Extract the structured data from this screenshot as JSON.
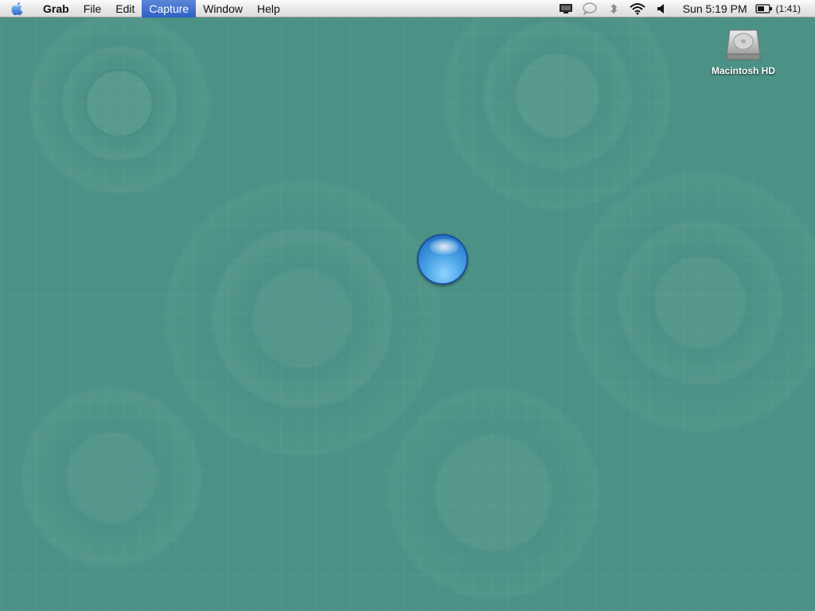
{
  "menubar": {
    "apple_icon": "apple-logo-icon",
    "app_name": "Grab",
    "menus": [
      "File",
      "Edit",
      "Capture",
      "Window",
      "Help"
    ],
    "active_menu": "Capture"
  },
  "status": {
    "icons": [
      "display-icon",
      "speech-bubble-icon",
      "bluetooth-icon",
      "wifi-icon",
      "volume-icon"
    ],
    "clock": "Sun 5:19 PM",
    "battery_time": "(1:41)"
  },
  "desktop": {
    "icons": [
      {
        "label": "Macintosh HD",
        "icon": "hard-drive-icon"
      }
    ],
    "wait_indicator": "blue-orb-cursor"
  },
  "colors": {
    "desktop_bg": "#4b9185",
    "menu_highlight": "#3b6bd0",
    "orb": "#3d94de"
  }
}
